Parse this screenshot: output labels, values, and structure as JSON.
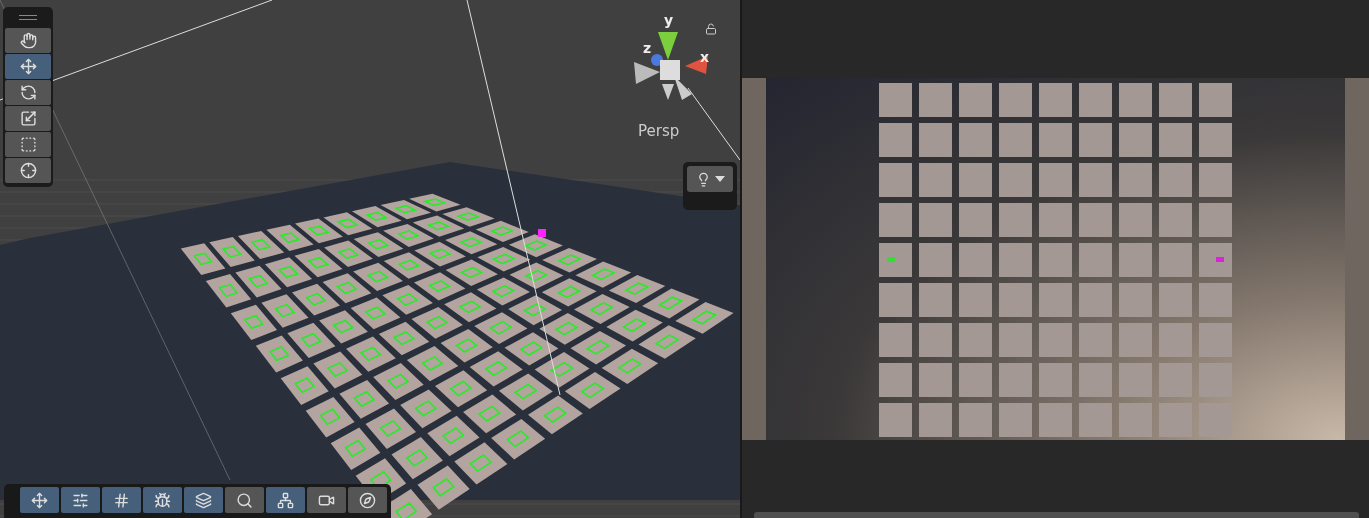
{
  "scene_view": {
    "tools": [
      {
        "kind": "hand",
        "selected": false
      },
      {
        "kind": "move",
        "selected": true
      },
      {
        "kind": "rotate",
        "selected": false
      },
      {
        "kind": "scale",
        "selected": false
      },
      {
        "kind": "rect",
        "selected": false
      },
      {
        "kind": "transform",
        "selected": false
      }
    ],
    "gizmo": {
      "axes": [
        {
          "kind": "y",
          "label": "y"
        },
        {
          "kind": "z",
          "label": "z"
        },
        {
          "kind": "x",
          "label": "x"
        }
      ],
      "projection": "Persp"
    },
    "overlay_toolbar": [
      {
        "kind": "move",
        "active": true
      },
      {
        "kind": "sliders",
        "active": true
      },
      {
        "kind": "grid",
        "active": true
      },
      {
        "kind": "bug",
        "active": true
      },
      {
        "kind": "layers",
        "active": true
      },
      {
        "kind": "search",
        "active": false
      },
      {
        "kind": "nodes",
        "active": true
      },
      {
        "kind": "camera",
        "active": false
      },
      {
        "kind": "compass",
        "active": false
      }
    ]
  }
}
